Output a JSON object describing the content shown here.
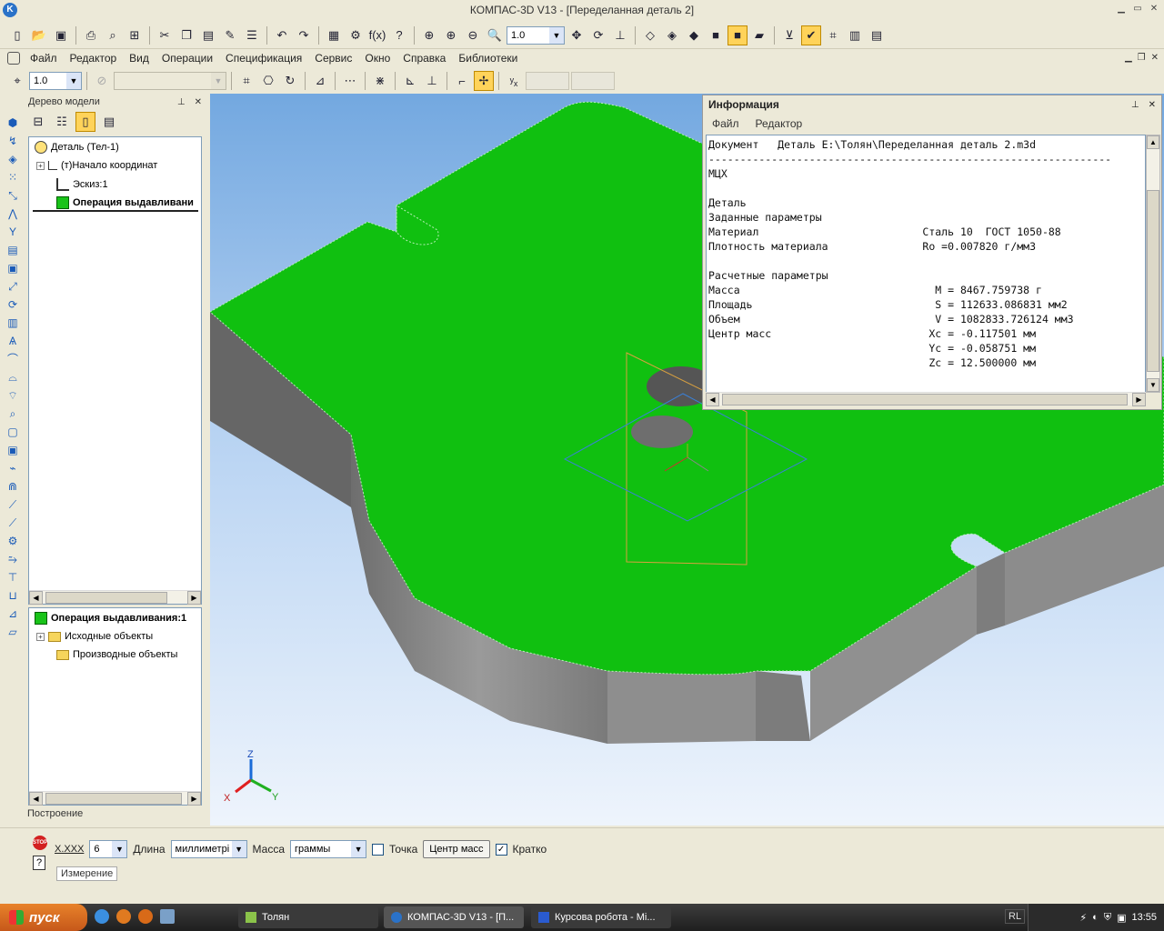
{
  "window": {
    "title": "КОМПАС-3D V13 - [Переделанная деталь 2]"
  },
  "menu": [
    "Файл",
    "Редактор",
    "Вид",
    "Операции",
    "Спецификация",
    "Сервис",
    "Окно",
    "Справка",
    "Библиотеки"
  ],
  "toolbar": {
    "zoom_value": "1.0",
    "step_value": "1.0"
  },
  "model_tree": {
    "title": "Дерево модели",
    "items": [
      {
        "label": "Деталь (Тел-1)"
      },
      {
        "label": "(т)Начало координат"
      },
      {
        "label": "Эскиз:1"
      },
      {
        "label": "Операция выдавливани"
      }
    ],
    "details_title": "Операция выдавливания:1",
    "details_items": [
      {
        "label": "Исходные объекты"
      },
      {
        "label": "Производные объекты"
      }
    ],
    "tab_label": "Построение"
  },
  "info_panel": {
    "title": "Информация",
    "menu": [
      "Файл",
      "Редактор"
    ],
    "lines": [
      "Документ   Деталь E:\\Толян\\Переделанная деталь 2.m3d",
      "----------------------------------------------------------------",
      "МЦХ",
      "",
      "Деталь",
      "Заданные параметры",
      "Материал                          Сталь 10  ГОСТ 1050-88",
      "Плотность материала               Ro =0.007820 г/мм3",
      "",
      "Расчетные параметры",
      "Масса                               M = 8467.759738 г",
      "Площадь                             S = 112633.086831 мм2",
      "Объем                               V = 1082833.726124 мм3",
      "Центр масс                         Xc = -0.117501 мм",
      "                                   Yc = -0.058751 мм",
      "                                   Zc = 12.500000 мм"
    ]
  },
  "axes": {
    "x": "X",
    "y": "Y",
    "z": "Z"
  },
  "props": {
    "precision_label": "X.XXX",
    "precision_value": "6",
    "length_label": "Длина",
    "length_value": "миллиметрі",
    "mass_label": "Масса",
    "mass_value": "граммы",
    "point_label": "Точка",
    "center_mass_button": "Центр масс",
    "brief_label": "Кратко",
    "brief_checked": "✓",
    "tab_label": "Измерение",
    "stop_label": "STOP",
    "help_label": "?"
  },
  "taskbar": {
    "start_label": "пуск",
    "tasks": [
      {
        "label": "Толян"
      },
      {
        "label": "КОМПАС-3D V13 - [П..."
      },
      {
        "label": "Курсова робота - Mi..."
      }
    ],
    "lang": "RL",
    "clock": "13:55"
  },
  "colors": {
    "part_top": "#10c010",
    "viewport_sky": "#73a8e0",
    "taskbar": "#2b2b2b"
  }
}
